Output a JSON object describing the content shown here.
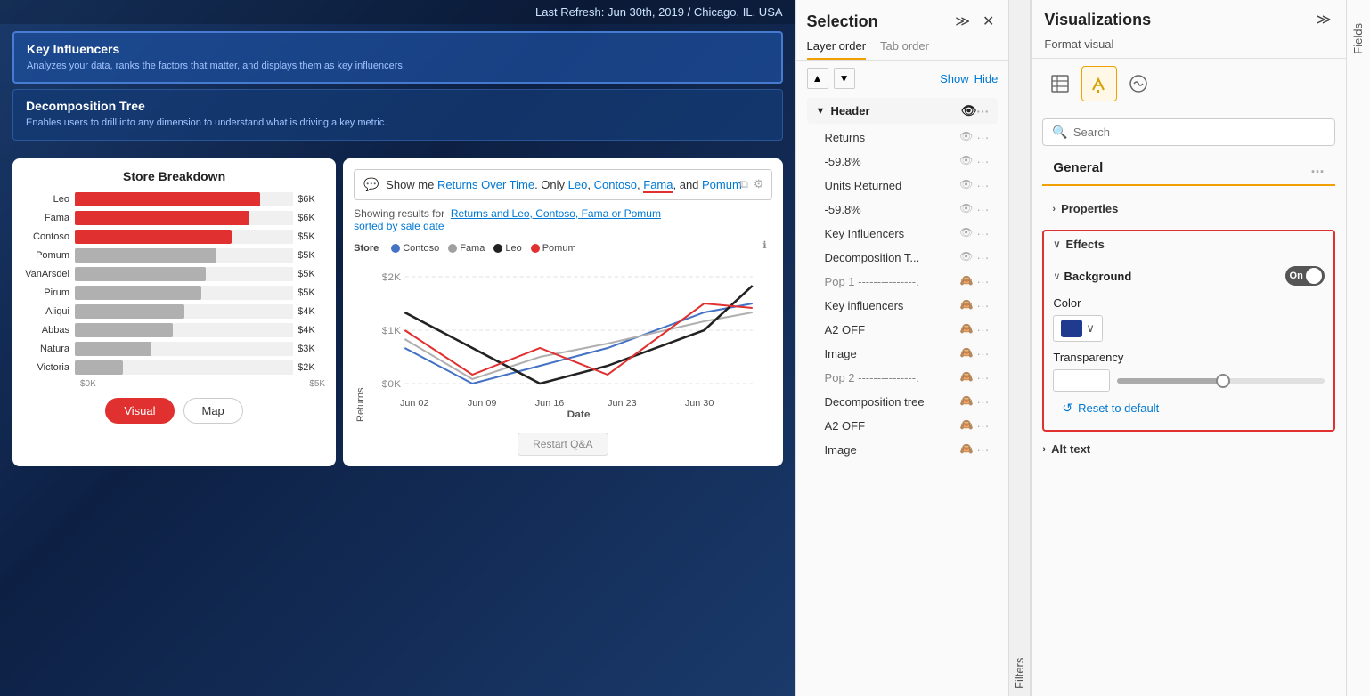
{
  "header": {
    "refresh_text": "Last Refresh: Jun 30th, 2019 / Chicago, IL, USA"
  },
  "viz_cards": [
    {
      "title": "Key Influencers",
      "description": "Analyzes your data, ranks the factors that matter, and displays them as key influencers."
    },
    {
      "title": "Decomposition Tree",
      "description": "Enables users to drill into any dimension to understand what is driving a key metric."
    }
  ],
  "bar_chart": {
    "title": "Store Breakdown",
    "bars": [
      {
        "label": "Leo",
        "value": "$6K",
        "pct": 85,
        "red": true
      },
      {
        "label": "Fama",
        "value": "$6K",
        "pct": 80,
        "red": true
      },
      {
        "label": "Contoso",
        "value": "$5K",
        "pct": 72,
        "red": true
      },
      {
        "label": "Pomum",
        "value": "$5K",
        "pct": 65,
        "red": false
      },
      {
        "label": "VanArsdel",
        "value": "$5K",
        "pct": 60,
        "red": false
      },
      {
        "label": "Pirum",
        "value": "$5K",
        "pct": 58,
        "red": false
      },
      {
        "label": "Aliqui",
        "value": "$4K",
        "pct": 50,
        "red": false
      },
      {
        "label": "Abbas",
        "value": "$4K",
        "pct": 45,
        "red": false
      },
      {
        "label": "Natura",
        "value": "$3K",
        "pct": 35,
        "red": false
      },
      {
        "label": "Victoria",
        "value": "$2K",
        "pct": 22,
        "red": false
      }
    ],
    "x_axis": [
      "$0K",
      "$5K"
    ],
    "tabs": [
      "Visual",
      "Map"
    ]
  },
  "qa_chart": {
    "input_text": "Show me Returns Over Time. Only Leo, Contoso, Fama, and Pomum",
    "result_label": "Showing results for",
    "result_link": "Returns and Leo, Contoso, Fama or Pomum sorted by sale date",
    "legend": [
      {
        "label": "Contoso",
        "color": "#4472C4"
      },
      {
        "label": "Fama",
        "color": "#a0a0a0"
      },
      {
        "label": "Leo",
        "color": "#222222"
      },
      {
        "label": "Pomum",
        "color": "#e03030"
      }
    ],
    "x_labels": [
      "Jun 02",
      "Jun 09",
      "Jun 16",
      "Jun 23",
      "Jun 30"
    ],
    "y_labels": [
      "$2K",
      "$1K",
      "$0K"
    ],
    "x_axis_label": "Date",
    "y_axis_label": "Returns",
    "restart_btn": "Restart Q&A"
  },
  "selection_panel": {
    "title": "Selection",
    "tabs": [
      "Layer order",
      "Tab order"
    ],
    "active_tab": "Layer order",
    "show_label": "Show",
    "hide_label": "Hide",
    "section_header": "Header",
    "layers": [
      {
        "name": "Returns",
        "visible": true,
        "dashed": false
      },
      {
        "name": "-59.8%",
        "visible": true,
        "dashed": false
      },
      {
        "name": "Units Returned",
        "visible": true,
        "dashed": false
      },
      {
        "name": "-59.8%",
        "visible": true,
        "dashed": false
      },
      {
        "name": "Key Influencers",
        "visible": true,
        "dashed": false
      },
      {
        "name": "Decomposition T...",
        "visible": true,
        "dashed": false
      },
      {
        "name": "Pop 1 ---------------.",
        "visible": false,
        "dashed": true
      },
      {
        "name": "Key influencers",
        "visible": false,
        "dashed": false
      },
      {
        "name": "A2 OFF",
        "visible": false,
        "dashed": false
      },
      {
        "name": "Image",
        "visible": false,
        "dashed": false
      },
      {
        "name": "Pop 2 ---------------.",
        "visible": false,
        "dashed": true
      },
      {
        "name": "Decomposition tree",
        "visible": false,
        "dashed": false
      },
      {
        "name": "A2 OFF",
        "visible": false,
        "dashed": false
      },
      {
        "name": "Image",
        "visible": false,
        "dashed": false
      }
    ],
    "filters_label": "Filters"
  },
  "viz_panel": {
    "title": "Visualizations",
    "expand_label": ">>",
    "format_label": "Format visual",
    "search_placeholder": "Search",
    "general_label": "General",
    "general_dots": "...",
    "properties_label": "Properties",
    "effects_label": "Effects",
    "background_label": "Background",
    "toggle_state": "On",
    "color_label": "Color",
    "color_hex": "#1f3a8f",
    "transparency_label": "Transparency",
    "transparency_value": "51 %",
    "reset_label": "Reset to default",
    "alt_text_label": "Alt text"
  },
  "fields_tab": {
    "label": "Fields"
  }
}
